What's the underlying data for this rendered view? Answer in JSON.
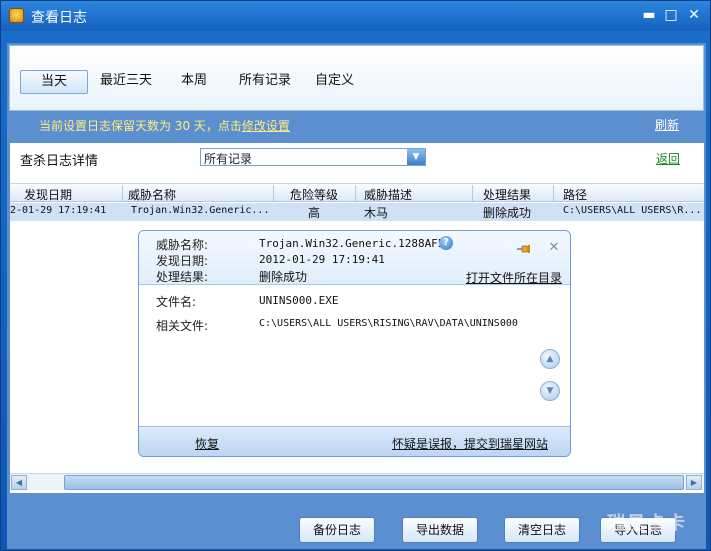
{
  "window": {
    "title": "查看日志"
  },
  "tabs": [
    {
      "label": "当天"
    },
    {
      "label": "最近三天"
    },
    {
      "label": "本周"
    },
    {
      "label": "所有记录"
    },
    {
      "label": "自定义"
    }
  ],
  "notice": {
    "prefix": "当前设置日志保留天数为 30 天，点击",
    "link": "修改设置"
  },
  "refresh_label": "刷新",
  "detail": {
    "label": "查杀日志详情",
    "filter_value": "所有记录",
    "back_label": "返回"
  },
  "table": {
    "columns": [
      "发现日期",
      "威胁名称",
      "危险等级",
      "威胁描述",
      "处理结果",
      "路径"
    ],
    "rows": [
      {
        "date": "2-01-29 17:19:41",
        "name": "Trojan.Win32.Generic...",
        "level": "高",
        "desc": "木马",
        "result": "删除成功",
        "path": "C:\\USERS\\ALL USERS\\R..."
      }
    ]
  },
  "popup": {
    "threat_name_label": "威胁名称:",
    "threat_name": "Trojan.Win32.Generic.1288AF58",
    "found_date_label": "发现日期:",
    "found_date": "2012-01-29 17:19:41",
    "result_label": "处理结果:",
    "result": "删除成功",
    "open_dir_label": "打开文件所在目录",
    "file_name_label": "文件名:",
    "file_name": "UNINS000.EXE",
    "related_label": "相关文件:",
    "related_file": "C:\\USERS\\ALL USERS\\RISING\\RAV\\DATA\\UNINS000",
    "restore_label": "恢复",
    "report_label": "怀疑是误报，提交到瑞星网站"
  },
  "buttons": {
    "backup": "备份日志",
    "export": "导出数据",
    "clear": "清空日志",
    "import": "导入日志"
  },
  "watermark": "瑞星卡卡"
}
